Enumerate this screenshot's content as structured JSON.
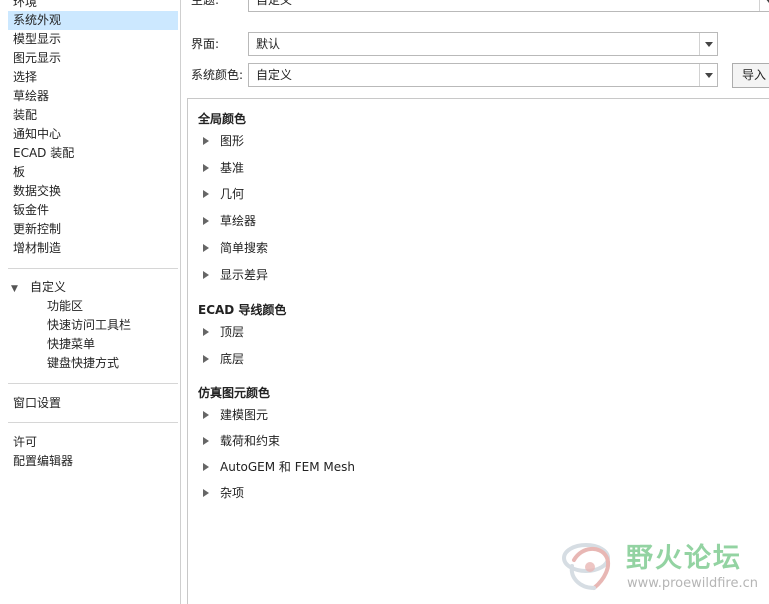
{
  "sidebar": {
    "items": [
      {
        "label": "环境"
      },
      {
        "label": "系统外观"
      },
      {
        "label": "模型显示"
      },
      {
        "label": "图元显示"
      },
      {
        "label": "选择"
      },
      {
        "label": "草绘器"
      },
      {
        "label": "装配"
      },
      {
        "label": "通知中心"
      },
      {
        "label": "ECAD 装配"
      },
      {
        "label": "板"
      },
      {
        "label": "数据交换"
      },
      {
        "label": "钣金件"
      },
      {
        "label": "更新控制"
      },
      {
        "label": "增材制造"
      }
    ],
    "selected_index": 1,
    "customize": {
      "label": "自定义",
      "children": [
        "功能区",
        "快速访问工具栏",
        "快捷菜单",
        "键盘快捷方式"
      ]
    },
    "window_settings": "窗口设置",
    "license": "许可",
    "config_editor": "配置编辑器"
  },
  "form": {
    "theme": {
      "label": "主题:",
      "value": "自定义"
    },
    "interface": {
      "label": "界面:",
      "value": "默认"
    },
    "system_colors": {
      "label": "系统颜色:",
      "value": "自定义"
    },
    "import_button": "导入"
  },
  "panel": {
    "sections": [
      {
        "title": "全局颜色",
        "items": [
          "图形",
          "基准",
          "几何",
          "草绘器",
          "简单搜索",
          "显示差异"
        ]
      },
      {
        "title": "ECAD 导线颜色",
        "items": [
          "顶层",
          "底层"
        ]
      },
      {
        "title": "仿真图元颜色",
        "items": [
          "建模图元",
          "载荷和约束",
          "AutoGEM 和 FEM Mesh",
          "杂项"
        ]
      }
    ]
  },
  "watermark": {
    "title": "野火论坛",
    "url": "www.proewildfire.cn",
    "color": "#93d3a2"
  },
  "colors": {
    "selection": "#cce8ff"
  }
}
